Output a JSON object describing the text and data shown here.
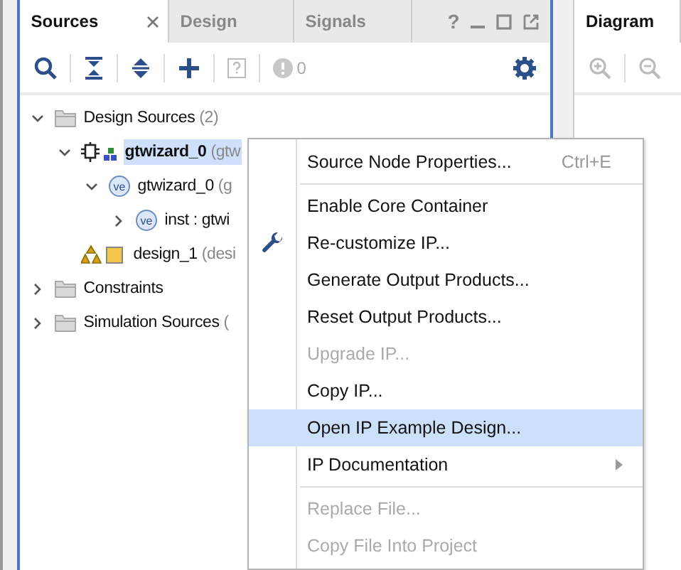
{
  "left_panel": {
    "tabs": [
      {
        "label": "Sources",
        "selected": true,
        "closable": true
      },
      {
        "label": "Design",
        "selected": false
      },
      {
        "label": "Signals",
        "selected": false
      }
    ],
    "window_controls": [
      "?"
    ],
    "toolbar": {
      "error_count": "0"
    },
    "tree": [
      {
        "kind": "folder",
        "name": "Design Sources",
        "detail": "(2)",
        "expanded": true,
        "selected": false,
        "children": [
          {
            "kind": "ip",
            "name": "gtwizard_0",
            "detail": "(gtw",
            "expanded": true,
            "selected": true,
            "children": [
              {
                "kind": "ve",
                "name": "gtwizard_0",
                "detail": "(g",
                "expanded": true,
                "selected": false,
                "children": [
                  {
                    "kind": "ve",
                    "name": "inst : gtwi",
                    "expanded": false,
                    "selected": false
                  }
                ]
              }
            ]
          },
          {
            "kind": "bd",
            "name": "design_1",
            "detail": "(desi",
            "selected": false
          }
        ]
      },
      {
        "kind": "folder",
        "name": "Constraints",
        "expanded": false,
        "selected": false
      },
      {
        "kind": "folder",
        "name": "Simulation Sources",
        "detail": "(",
        "expanded": false,
        "selected": false
      }
    ]
  },
  "right_panel": {
    "tabs": [
      {
        "label": "Diagram",
        "selected": true
      }
    ]
  },
  "context_menu": {
    "items": [
      {
        "kind": "item",
        "label": "Source Node Properties...",
        "shortcut": "Ctrl+E",
        "disabled": false,
        "selected": false
      },
      {
        "kind": "separator"
      },
      {
        "kind": "item",
        "label": "Enable Core Container",
        "disabled": false,
        "selected": false
      },
      {
        "kind": "item",
        "label": "Re-customize IP...",
        "icon": true,
        "disabled": false,
        "selected": false
      },
      {
        "kind": "item",
        "label": "Generate Output Products...",
        "disabled": false,
        "selected": false
      },
      {
        "kind": "item",
        "label": "Reset Output Products...",
        "disabled": false,
        "selected": false
      },
      {
        "kind": "item",
        "label": "Upgrade IP...",
        "disabled": true,
        "selected": false
      },
      {
        "kind": "item",
        "label": "Copy IP...",
        "disabled": false,
        "selected": false
      },
      {
        "kind": "item",
        "label": "Open IP Example Design...",
        "disabled": false,
        "selected": true
      },
      {
        "kind": "item",
        "label": "IP Documentation",
        "submenu": true,
        "disabled": false,
        "selected": false
      },
      {
        "kind": "separator"
      },
      {
        "kind": "item",
        "label": "Replace File...",
        "disabled": true,
        "selected": false
      },
      {
        "kind": "item",
        "label": "Copy File Into Project",
        "disabled": true,
        "selected": false
      }
    ]
  }
}
